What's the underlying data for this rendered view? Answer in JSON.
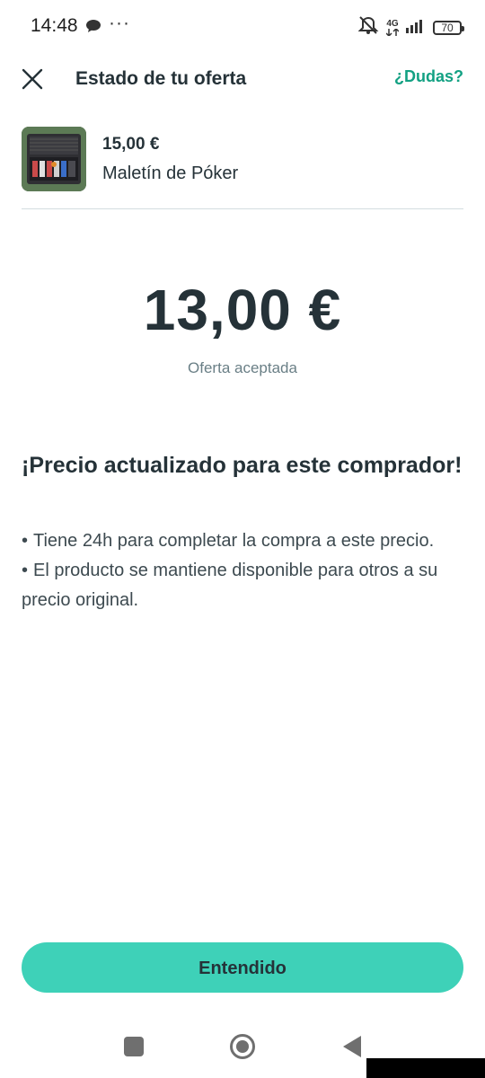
{
  "status_bar": {
    "time": "14:48",
    "dots": "···",
    "network": "4G",
    "battery": "70"
  },
  "header": {
    "title": "Estado de tu oferta",
    "help": "¿Dudas?"
  },
  "product": {
    "price": "15,00 €",
    "name": "Maletín de Póker"
  },
  "offer": {
    "amount": "13,00 €",
    "status": "Oferta aceptada"
  },
  "info": {
    "title": "¡Precio actualizado para este comprador!",
    "bullets": [
      "Tiene 24h para completar la compra a este precio.",
      "El producto se mantiene disponible para otros a su precio original."
    ]
  },
  "cta": {
    "label": "Entendido"
  },
  "colors": {
    "accent": "#3ed1b8",
    "link": "#13a183",
    "text": "#253238"
  },
  "icons": [
    "chat-bubble-icon",
    "mute-icon",
    "signal-icon",
    "battery-icon",
    "close-icon",
    "recents-icon",
    "home-icon",
    "back-icon"
  ]
}
